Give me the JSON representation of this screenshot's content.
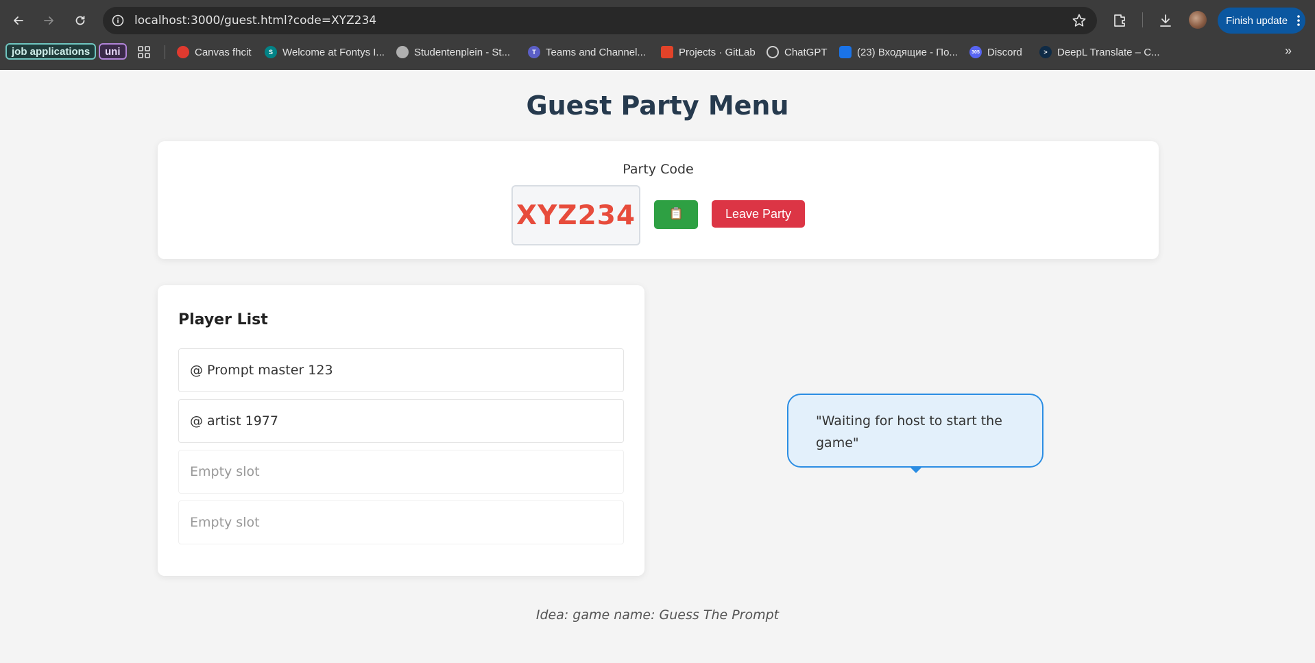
{
  "browser": {
    "url": "localhost:3000/guest.html?code=XYZ234",
    "finish_update_label": "Finish update",
    "bookmarks": {
      "chips": [
        "job applications",
        "uni"
      ],
      "items": [
        {
          "label": "Canvas fhcit",
          "icon": "canvas-icon",
          "color": "#e03a2f"
        },
        {
          "label": "Welcome at Fontys I...",
          "icon": "sharepoint-icon",
          "color": "#038387"
        },
        {
          "label": "Studentenplein - St...",
          "icon": "globe-icon",
          "color": "#b0b0b0"
        },
        {
          "label": "Teams and Channel...",
          "icon": "teams-icon",
          "color": "#5b5fc7"
        },
        {
          "label": "Projects · GitLab",
          "icon": "gitlab-icon",
          "color": "#e24329"
        },
        {
          "label": "ChatGPT",
          "icon": "chatgpt-icon",
          "color": "#d0d0d0"
        },
        {
          "label": "(23) Входящие - По...",
          "icon": "mail-icon",
          "color": "#1a73e8"
        },
        {
          "label": "Discord",
          "icon": "discord-icon",
          "color": "#5865f2",
          "badge": "305"
        },
        {
          "label": "DeepL Translate – C...",
          "icon": "deepl-icon",
          "color": "#0f2b46"
        }
      ]
    }
  },
  "page": {
    "title": "Guest Party Menu",
    "party_code_label": "Party Code",
    "party_code": "XYZ234",
    "copy_icon": "clipboard-icon",
    "leave_label": "Leave Party",
    "player_list_title": "Player List",
    "players": [
      "@ Prompt master 123",
      "@ artist 1977",
      "Empty slot",
      "Empty slot"
    ],
    "waiting_message": "\"Waiting for host to start the game\"",
    "idea_note": "Idea: game name: Guess The Prompt"
  },
  "colors": {
    "title": "#263a4e",
    "code": "#e74c3c",
    "copy_button": "#2ea043",
    "leave_button": "#dc3545",
    "bubble_border": "#2b8de3",
    "bubble_bg": "#e3f0fb"
  }
}
